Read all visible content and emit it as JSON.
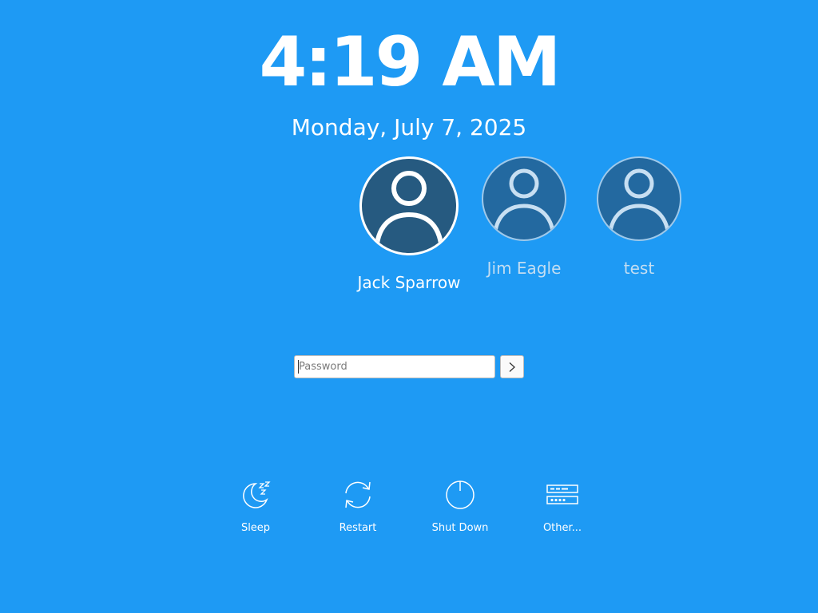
{
  "clock": {
    "time": "4:19 AM",
    "date": "Monday, July 7, 2025"
  },
  "users": [
    {
      "name": "Jack Sparrow",
      "selected": true,
      "icon": "user-avatar-icon"
    },
    {
      "name": "Jim Eagle",
      "selected": false,
      "icon": "user-avatar-icon"
    },
    {
      "name": "test",
      "selected": false,
      "icon": "user-avatar-icon"
    }
  ],
  "login": {
    "password_placeholder": "Password",
    "password_value": "",
    "submit_icon": "chevron-right-icon"
  },
  "actions": [
    {
      "label": "Sleep",
      "icon": "sleep-icon"
    },
    {
      "label": "Restart",
      "icon": "restart-icon"
    },
    {
      "label": "Shut Down",
      "icon": "power-icon"
    },
    {
      "label": "Other...",
      "icon": "other-options-icon"
    }
  ],
  "colors": {
    "background": "#1e9af4",
    "selected_avatar": "#265a80",
    "other_avatar": "#2369a0",
    "text": "#ffffff"
  }
}
